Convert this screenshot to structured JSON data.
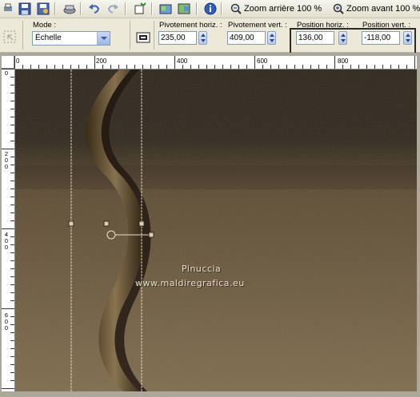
{
  "toolbar": {
    "zoom_out_label": "Zoom arrière 100 %",
    "zoom_in_label": "Zoom avant 100 %"
  },
  "options": {
    "mode_label": "Mode :",
    "mode_value": "Échelle",
    "pivot_h_label": "Pivotement horiz. :",
    "pivot_h_value": "235,00",
    "pivot_v_label": "Pivotement vert. :",
    "pivot_v_value": "409,00",
    "pos_h_label": "Position horiz. :",
    "pos_h_value": "136,00",
    "pos_v_label": "Position vert. :",
    "pos_v_value": "-118,00"
  },
  "ruler_h_labels": [
    "0",
    "200",
    "400",
    "600",
    "800"
  ],
  "ruler_v_labels": [
    "0",
    "200",
    "400",
    "600"
  ],
  "watermark": {
    "line1": "Pinuccia",
    "line2": "www.maldiregrafica.eu"
  },
  "colors": {
    "canvas_dark": "#2e2519",
    "canvas_light": "#7a6647",
    "highlight_border": "#2b2b2b"
  }
}
